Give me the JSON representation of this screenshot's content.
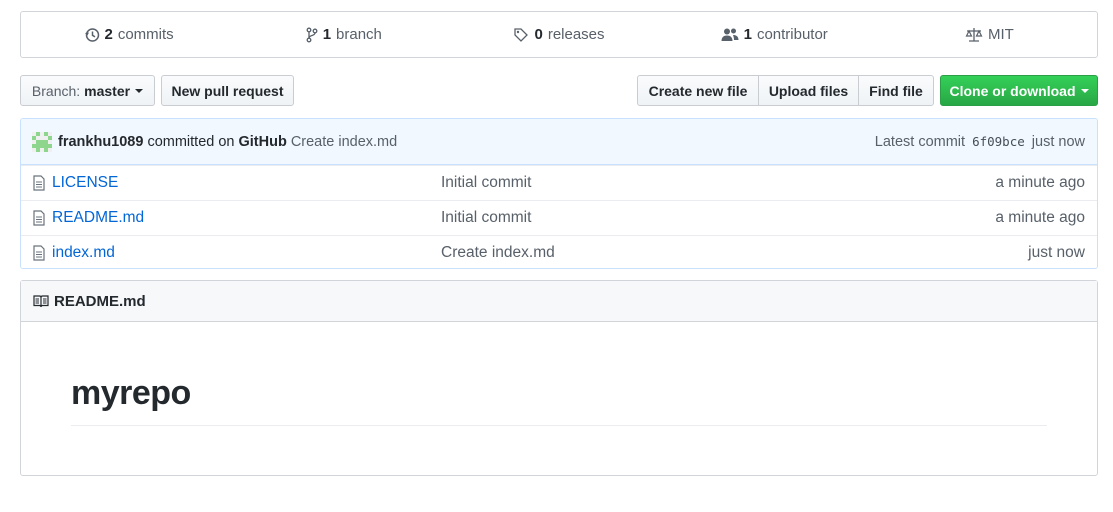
{
  "summary": {
    "commits": {
      "num": "2",
      "label": "commits",
      "icon": "history-icon"
    },
    "branches": {
      "num": "1",
      "label": "branch",
      "icon": "git-branch-icon"
    },
    "releases": {
      "num": "0",
      "label": "releases",
      "icon": "tag-icon"
    },
    "contributors": {
      "num": "1",
      "label": "contributor",
      "icon": "people-icon"
    },
    "license": {
      "label": "MIT",
      "icon": "law-icon"
    }
  },
  "toolbar": {
    "branch_prefix": "Branch:",
    "branch_name": "master",
    "new_pr": "New pull request",
    "create_file": "Create new file",
    "upload_files": "Upload files",
    "find_file": "Find file",
    "clone": "Clone or download",
    "clone_color": "#28a745"
  },
  "commit": {
    "author": "frankhu1089",
    "committed_on": "committed on",
    "platform": "GitHub",
    "message": "Create index.md",
    "latest_label": "Latest commit",
    "sha": "6f09bce",
    "time": "just now"
  },
  "files": [
    {
      "name": "LICENSE",
      "message": "Initial commit",
      "age": "a minute ago"
    },
    {
      "name": "README.md",
      "message": "Initial commit",
      "age": "a minute ago"
    },
    {
      "name": "index.md",
      "message": "Create index.md",
      "age": "just now"
    }
  ],
  "readme": {
    "filename": "README.md",
    "heading": "myrepo"
  }
}
